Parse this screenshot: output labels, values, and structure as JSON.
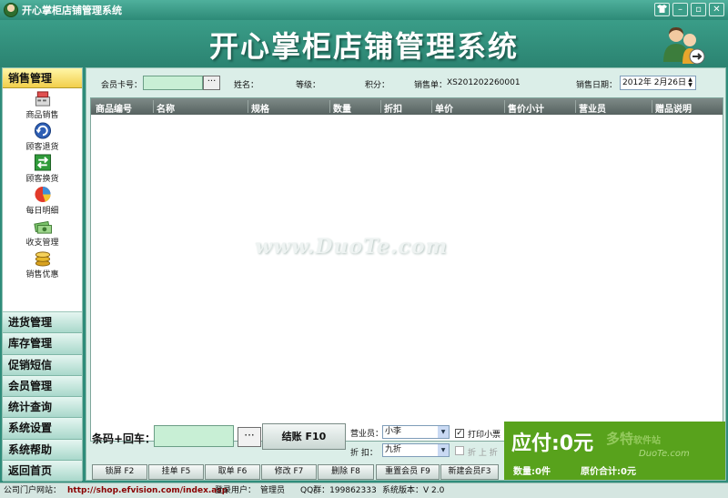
{
  "window": {
    "title": "开心掌柜店铺管理系统",
    "controls": [
      "shirt-icon",
      "minimize-icon",
      "restore-icon",
      "close-icon"
    ]
  },
  "banner": {
    "title": "开心掌柜店铺管理系统"
  },
  "sidebar": {
    "active_section": "销售管理",
    "subitems": [
      {
        "label": "商品销售",
        "icon": "cashier-icon"
      },
      {
        "label": "顾客退货",
        "icon": "return-icon"
      },
      {
        "label": "顾客换货",
        "icon": "exchange-icon"
      },
      {
        "label": "每日明细",
        "icon": "pie-chart-icon"
      },
      {
        "label": "收支管理",
        "icon": "money-icon"
      },
      {
        "label": "销售优惠",
        "icon": "coins-icon"
      }
    ],
    "sections": [
      "进货管理",
      "库存管理",
      "促销短信",
      "会员管理",
      "统计查询",
      "系统设置",
      "系统帮助",
      "返回首页"
    ]
  },
  "form": {
    "member_card_label": "会员卡号：",
    "member_card_value": "",
    "browse_label": "···",
    "name_label": "姓名：",
    "level_label": "等级：",
    "points_label": "积分：",
    "order_label": "销售单：",
    "order_no": "XS201202260001",
    "date_label": "销售日期：",
    "date_value": "2012年 2月26日"
  },
  "table": {
    "columns": [
      "商品编号",
      "名称",
      "规格",
      "数量",
      "折扣",
      "单价",
      "售价小计",
      "营业员",
      "赠品说明"
    ],
    "rows": []
  },
  "watermark": "www.DuoTe.com",
  "bottom": {
    "barcode_label": "条码+回车：",
    "barcode_value": "",
    "browse_label": "···",
    "checkout_label": "结账 F10",
    "clerk_label": "营业员：",
    "clerk_value": "小李",
    "discount_label": "折  扣：",
    "discount_value": "九折",
    "print_receipt_label": "打印小票",
    "print_receipt_checked": "✓",
    "stack_discount_label": "折 上 折",
    "function_buttons": [
      "锁屏 F2",
      "挂单 F5",
      "取单 F6",
      "修改 F7",
      "删除 F8",
      "重置会员 F9",
      "新建会员F3"
    ]
  },
  "totals": {
    "due_label": "应付:0元",
    "qty_label": "数量:0件",
    "orig_label": "原价合计:0元",
    "panel_color": "#58a21c"
  },
  "watermark_logo": {
    "brand": "多特",
    "suffix": "软件站",
    "url": "DuoTe.com"
  },
  "status": {
    "site_label": "公司门户网站：",
    "site_url": "http://shop.efvision.com/index.asp",
    "user_label": "登录用户：",
    "user_value": "管理员",
    "qq_label": "QQ群：199862333",
    "version_label": "系统版本：V 2.0"
  }
}
